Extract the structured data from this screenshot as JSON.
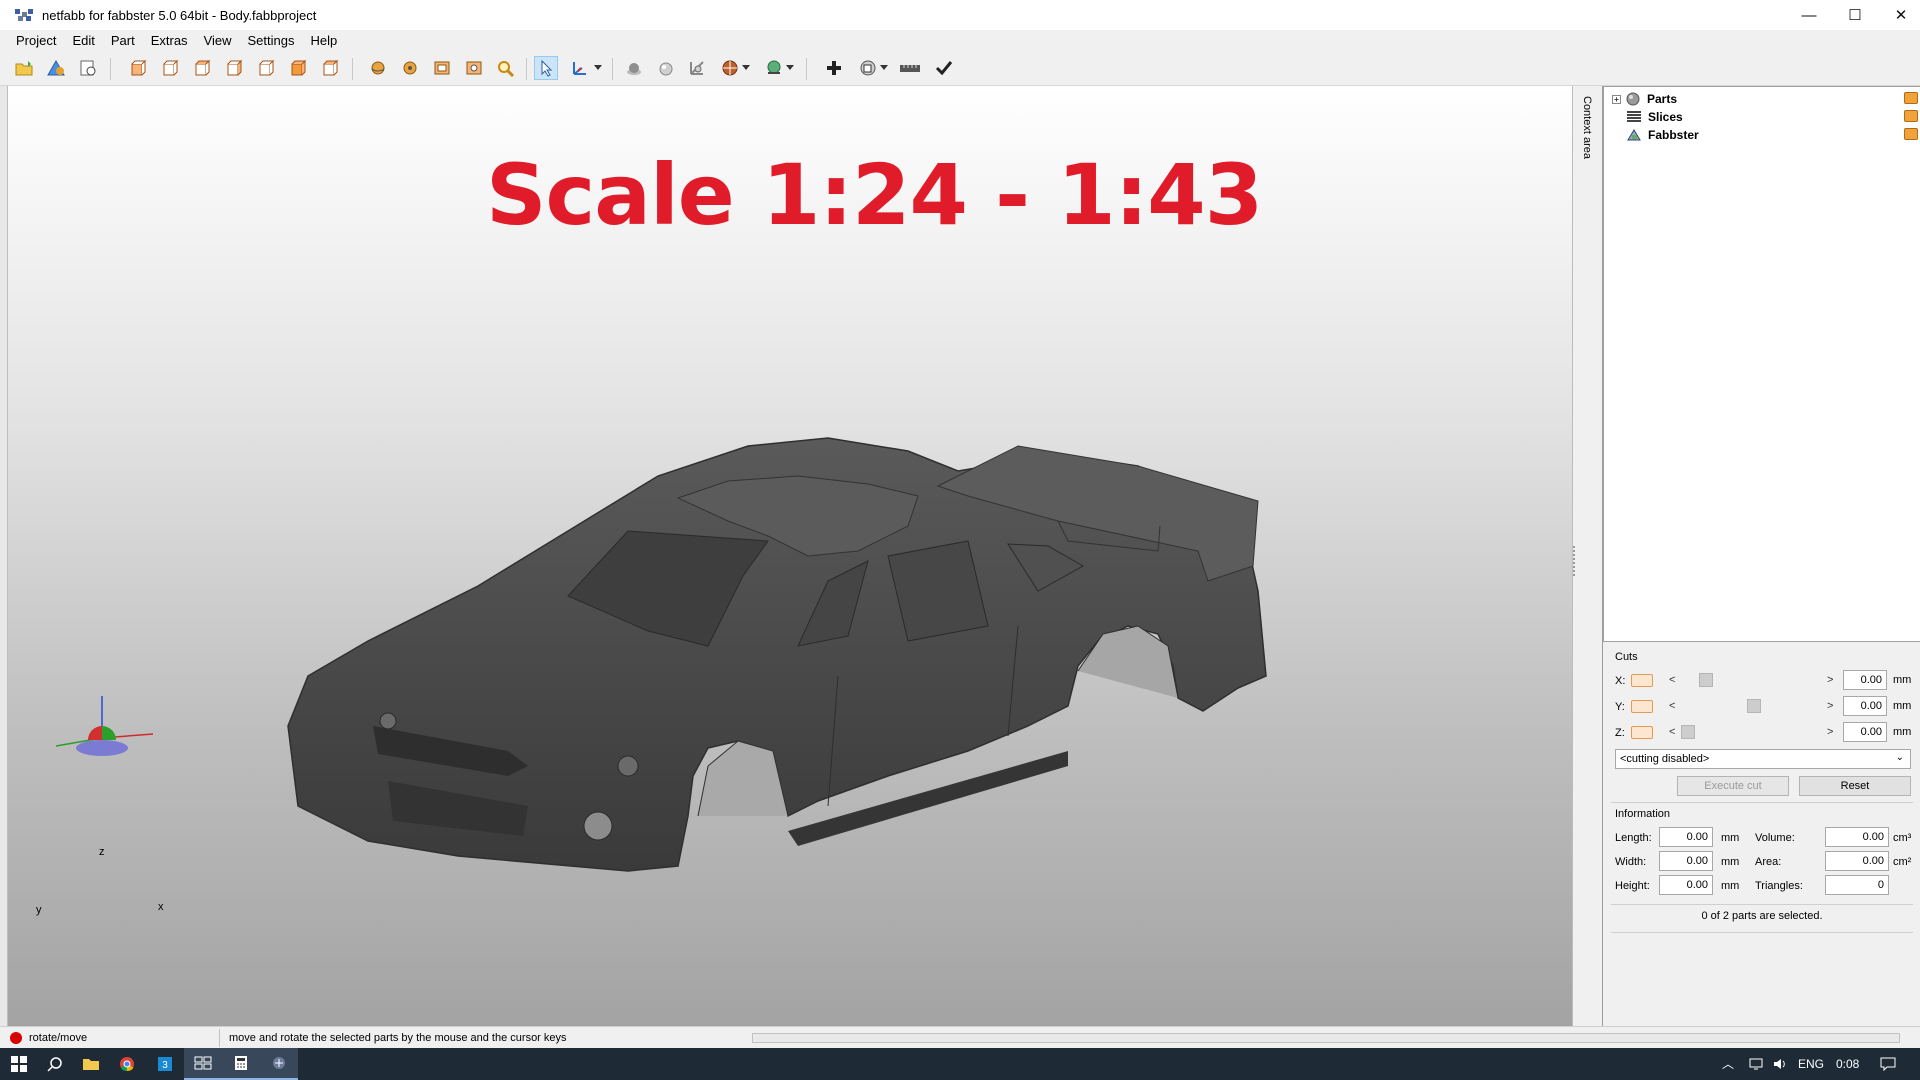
{
  "window": {
    "title": "netfabb for fabbster 5.0 64bit - Body.fabbproject",
    "minimize": "—",
    "maximize": "☐",
    "close": "✕"
  },
  "menu": [
    "Project",
    "Edit",
    "Part",
    "Extras",
    "View",
    "Settings",
    "Help"
  ],
  "toolbar": {
    "icons": [
      "open-project-icon",
      "add-part-icon",
      "project-info-icon",
      "view-front-icon",
      "view-back-icon",
      "view-left-icon",
      "view-right-icon",
      "view-top-icon",
      "view-bottom-icon",
      "view-iso-icon",
      "rotate-view-icon",
      "pan-view-icon",
      "zoom-fit-icon",
      "zoom-selection-icon",
      "zoom-icon",
      "select-cursor-icon",
      "move-axes-icon",
      "shading-icon",
      "surface-icon",
      "measure-icon",
      "color-icon",
      "display-mode-icon",
      "add-icon",
      "repair-icon",
      "ruler-icon",
      "checkmark-icon"
    ]
  },
  "viewport": {
    "overlay_text": "Scale 1:24 - 1:43",
    "axes": {
      "x": "x",
      "y": "y",
      "z": "z"
    }
  },
  "context_area_label": "Context area",
  "tree": {
    "items": [
      {
        "label": "Parts",
        "expander": "+"
      },
      {
        "label": "Slices"
      },
      {
        "label": "Fabbster"
      }
    ]
  },
  "cuts": {
    "title": "Cuts",
    "rows": [
      {
        "axis": "X:",
        "value": "0.00",
        "unit": "mm",
        "left": "<",
        "right": ">"
      },
      {
        "axis": "Y:",
        "value": "0.00",
        "unit": "mm",
        "left": "<",
        "right": ">"
      },
      {
        "axis": "Z:",
        "value": "0.00",
        "unit": "mm",
        "left": "<",
        "right": ">"
      }
    ],
    "mode_select": "<cutting disabled>",
    "execute_button": "Execute cut",
    "reset_button": "Reset"
  },
  "information": {
    "title": "Information",
    "length_label": "Length:",
    "length_value": "0.00",
    "length_unit": "mm",
    "width_label": "Width:",
    "width_value": "0.00",
    "width_unit": "mm",
    "height_label": "Height:",
    "height_value": "0.00",
    "height_unit": "mm",
    "volume_label": "Volume:",
    "volume_value": "0.00",
    "volume_unit": "cm³",
    "area_label": "Area:",
    "area_value": "0.00",
    "area_unit": "cm²",
    "triangles_label": "Triangles:",
    "triangles_value": "0",
    "selection_status": "0 of 2 parts are selected."
  },
  "statusbar": {
    "mode": "rotate/move",
    "message": "move and rotate the selected parts by the mouse and the cursor keys"
  },
  "taskbar": {
    "language": "ENG",
    "time": "0:08",
    "app_icons": [
      "windows-start-icon",
      "search-icon",
      "file-explorer-icon",
      "chrome-icon",
      "app-3-icon",
      "task-view-icon",
      "calculator-icon",
      "netfabb-icon"
    ]
  },
  "colors": {
    "overlay_text": "#e11c2a",
    "car_body": "#4b4b4b",
    "taskbar": "#1e2a35"
  }
}
